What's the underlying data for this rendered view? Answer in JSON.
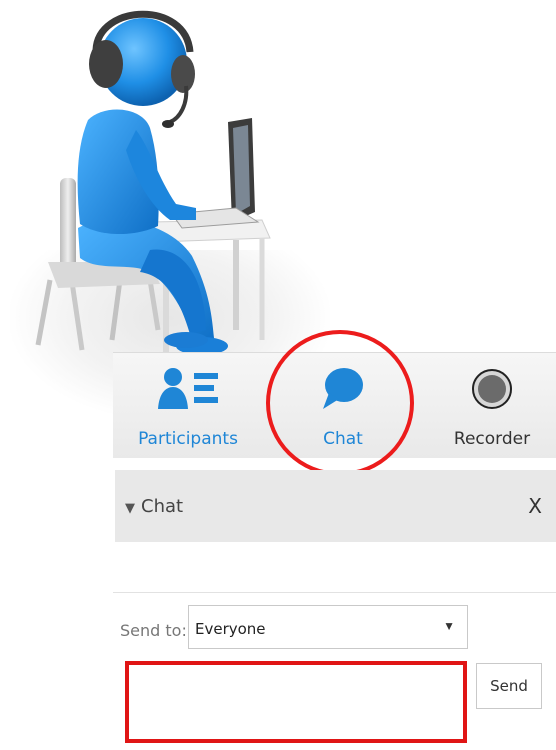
{
  "toolbar": {
    "participants_label": "Participants",
    "chat_label": "Chat",
    "recorder_label": "Recorder",
    "icons": [
      "participants-icon",
      "chat-bubble-icon",
      "record-icon"
    ],
    "accent_color": "#1f86d6"
  },
  "chat_panel": {
    "title": "Chat",
    "close_label": "X"
  },
  "send": {
    "to_label": "Send to:",
    "recipient": "Everyone",
    "message_value": "",
    "button_label": "Send"
  },
  "highlight_color": "#ec1c1c"
}
